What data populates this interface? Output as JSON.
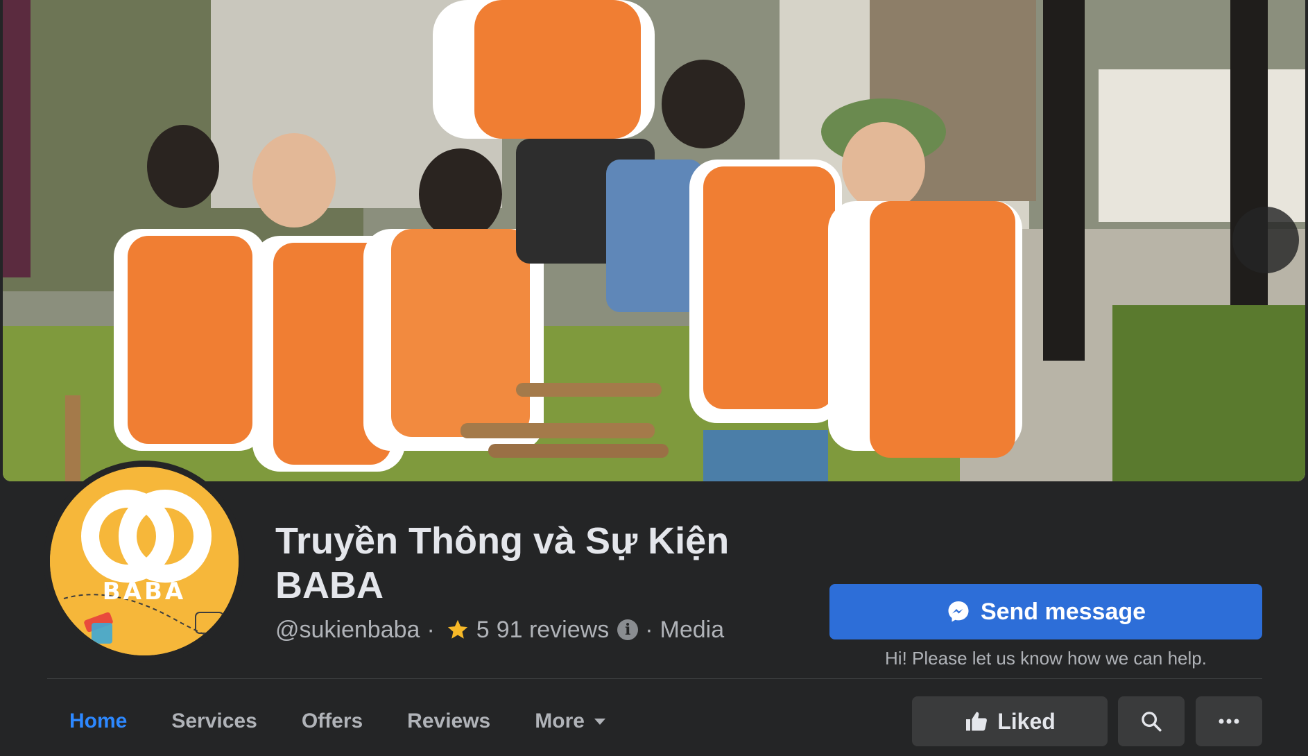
{
  "page": {
    "title": "Truyền Thông và Sự Kiện BABA",
    "username": "@sukienbaba",
    "rating_prefix": "5",
    "reviews_text": "91 reviews",
    "category": "Media",
    "logo_text": "BABA"
  },
  "actions": {
    "send_message": "Send message",
    "help_text": "Hi! Please let us know how we can help.",
    "liked": "Liked"
  },
  "tabs": [
    {
      "label": "Home",
      "active": true
    },
    {
      "label": "Services",
      "active": false
    },
    {
      "label": "Offers",
      "active": false
    },
    {
      "label": "Reviews",
      "active": false
    },
    {
      "label": "More",
      "active": false
    }
  ],
  "icons": {
    "star": "star-icon",
    "info": "info-icon",
    "messenger": "messenger-icon",
    "like": "thumbs-up-icon",
    "search": "search-icon",
    "more": "ellipsis-icon",
    "next": "chevron-right-icon"
  },
  "colors": {
    "background": "#242526",
    "primary": "#2d6ed8",
    "active_tab": "#2d88ff",
    "star": "#f7b928",
    "logo": "#f6b73a"
  }
}
